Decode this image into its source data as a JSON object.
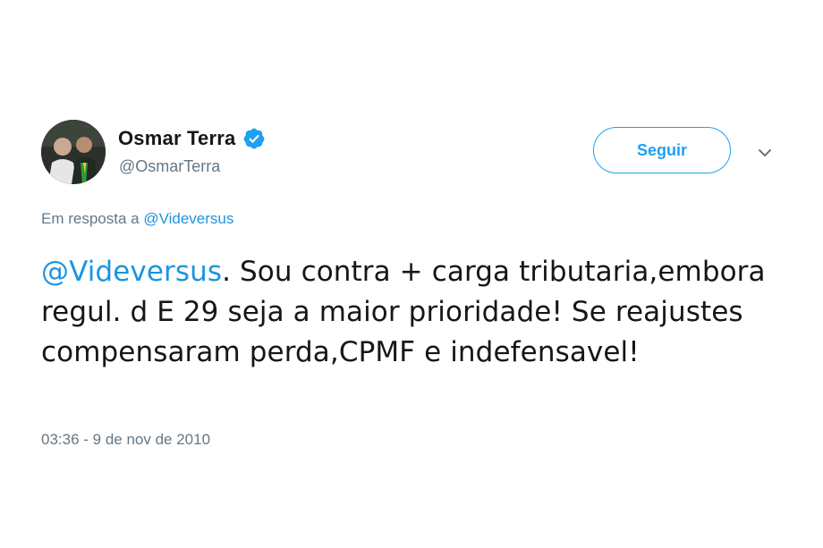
{
  "author": {
    "display_name": "Osmar Terra",
    "handle": "@OsmarTerra",
    "verified_icon": "verified-badge-icon"
  },
  "actions": {
    "follow_label": "Seguir",
    "menu_icon": "chevron-down-icon"
  },
  "reply": {
    "prefix": "Em resposta a ",
    "mention": "@Videversus"
  },
  "tweet": {
    "mention": "@Videversus",
    "text": ". Sou contra + carga tributaria,embora regul. d E 29 seja a maior prioridade! Se reajustes compensaram perda,CPMF e indefensavel!"
  },
  "timestamp": "03:36 - 9 de nov de 2010",
  "colors": {
    "accent": "#1da1f2",
    "link": "#1b95e0",
    "muted": "#657786",
    "text": "#14171a"
  }
}
